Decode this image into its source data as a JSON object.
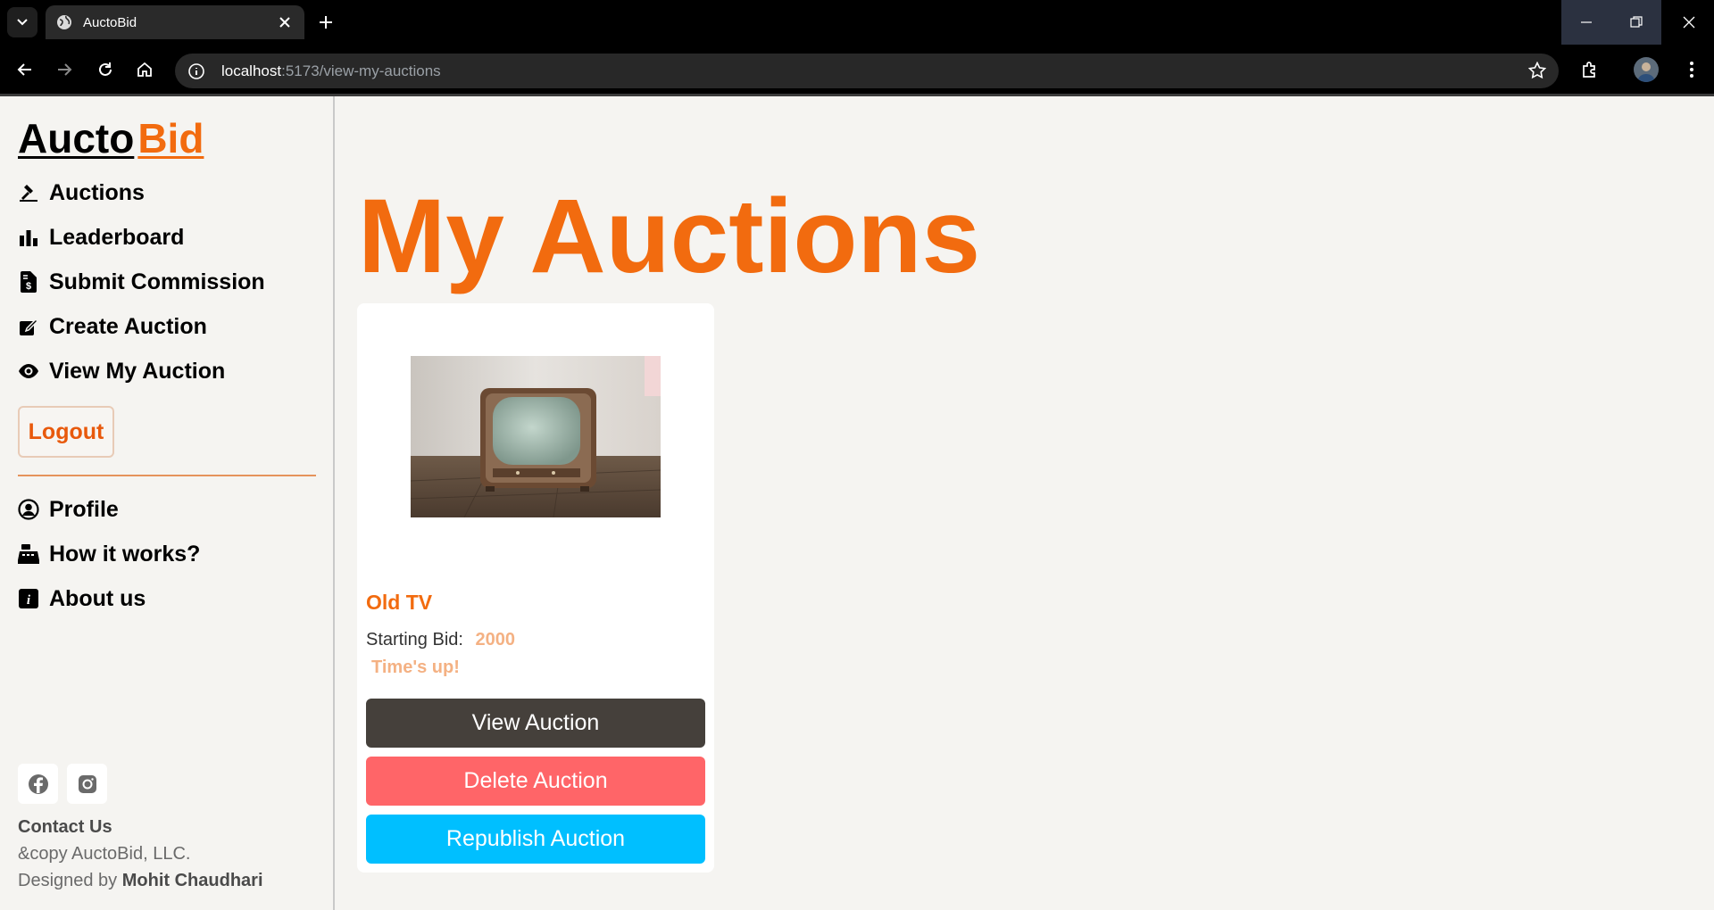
{
  "browser": {
    "tab_title": "AuctoBid",
    "url_host": "localhost",
    "url_rest": ":5173/view-my-auctions"
  },
  "sidebar": {
    "logo_part1": "Aucto",
    "logo_part2": "Bid",
    "nav": [
      {
        "label": "Auctions",
        "icon": "gavel-icon"
      },
      {
        "label": "Leaderboard",
        "icon": "bar-chart-icon"
      },
      {
        "label": "Submit Commission",
        "icon": "invoice-dollar-icon"
      },
      {
        "label": "Create Auction",
        "icon": "edit-icon"
      },
      {
        "label": "View My Auction",
        "icon": "eye-icon"
      }
    ],
    "logout_label": "Logout",
    "secondary_nav": [
      {
        "label": "Profile",
        "icon": "user-circle-icon"
      },
      {
        "label": "How it works?",
        "icon": "cash-register-icon"
      },
      {
        "label": "About us",
        "icon": "info-square-icon"
      }
    ],
    "contact_label": "Contact Us",
    "copyright": "&copy AuctoBid, LLC.",
    "designed_prefix": "Designed by",
    "designed_by": "Mohit Chaudhari"
  },
  "main": {
    "title": "My Auctions",
    "cards": [
      {
        "title": "Old TV",
        "starting_bid_label": "Starting Bid:",
        "starting_bid_value": "2000",
        "status": "Time's up!",
        "view_label": "View Auction",
        "delete_label": "Delete Auction",
        "republish_label": "Republish Auction"
      }
    ]
  },
  "colors": {
    "accent": "#f26b0f",
    "view_button": "#45403b",
    "delete_button": "#ff6568",
    "republish_button": "#00bfff"
  }
}
